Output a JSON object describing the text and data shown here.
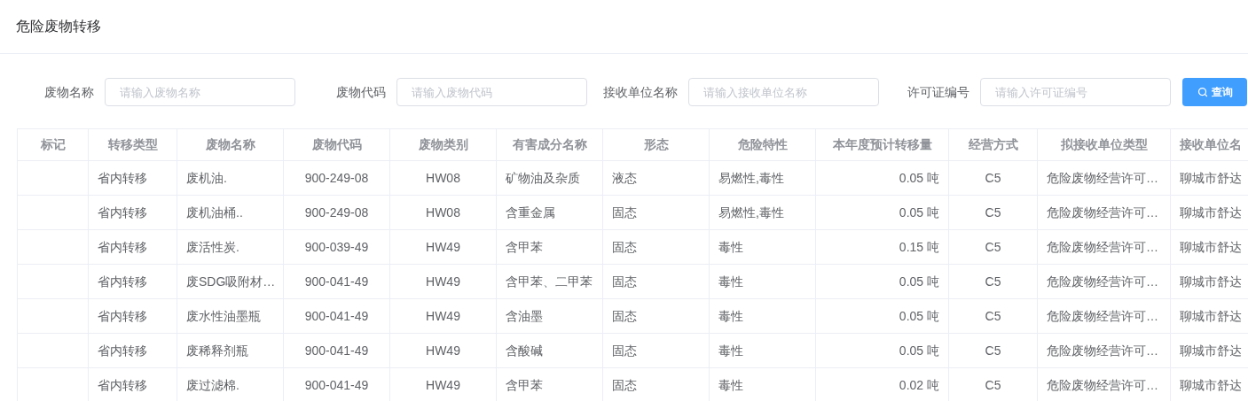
{
  "page": {
    "title": "危险废物转移"
  },
  "filters": [
    {
      "label": "废物名称",
      "placeholder": "请输入废物名称"
    },
    {
      "label": "废物代码",
      "placeholder": "请输入废物代码"
    },
    {
      "label": "接收单位名称",
      "placeholder": "请输入接收单位名称"
    },
    {
      "label": "许可证编号",
      "placeholder": "请输入许可证编号"
    }
  ],
  "search_button": {
    "label": "查询"
  },
  "table": {
    "columns": [
      "标记",
      "转移类型",
      "废物名称",
      "废物代码",
      "废物类别",
      "有害成分名称",
      "形态",
      "危险特性",
      "本年度预计转移量",
      "经营方式",
      "拟接收单位类型",
      "接收单位名"
    ],
    "rows": [
      {
        "transfer_type": "省内转移",
        "waste_name": "废机油.",
        "waste_code": "900-249-08",
        "waste_category": "HW08",
        "hazardous_component": "矿物油及杂质",
        "form": "液态",
        "hazard_property": "易燃性,毒性",
        "annual_amount": "0.05 吨",
        "operation_mode": "C5",
        "receiver_type": "危险废物经营许可…",
        "receiver_name": "聊城市舒达"
      },
      {
        "transfer_type": "省内转移",
        "waste_name": "废机油桶..",
        "waste_code": "900-249-08",
        "waste_category": "HW08",
        "hazardous_component": "含重金属",
        "form": "固态",
        "hazard_property": "易燃性,毒性",
        "annual_amount": "0.05 吨",
        "operation_mode": "C5",
        "receiver_type": "危险废物经营许可…",
        "receiver_name": "聊城市舒达"
      },
      {
        "transfer_type": "省内转移",
        "waste_name": "废活性炭.",
        "waste_code": "900-039-49",
        "waste_category": "HW49",
        "hazardous_component": "含甲苯",
        "form": "固态",
        "hazard_property": "毒性",
        "annual_amount": "0.15 吨",
        "operation_mode": "C5",
        "receiver_type": "危险废物经营许可…",
        "receiver_name": "聊城市舒达"
      },
      {
        "transfer_type": "省内转移",
        "waste_name": "废SDG吸附材…",
        "waste_code": "900-041-49",
        "waste_category": "HW49",
        "hazardous_component": "含甲苯、二甲苯",
        "form": "固态",
        "hazard_property": "毒性",
        "annual_amount": "0.05 吨",
        "operation_mode": "C5",
        "receiver_type": "危险废物经营许可…",
        "receiver_name": "聊城市舒达"
      },
      {
        "transfer_type": "省内转移",
        "waste_name": "废水性油墨瓶",
        "waste_code": "900-041-49",
        "waste_category": "HW49",
        "hazardous_component": "含油墨",
        "form": "固态",
        "hazard_property": "毒性",
        "annual_amount": "0.05 吨",
        "operation_mode": "C5",
        "receiver_type": "危险废物经营许可…",
        "receiver_name": "聊城市舒达"
      },
      {
        "transfer_type": "省内转移",
        "waste_name": "废稀释剂瓶",
        "waste_code": "900-041-49",
        "waste_category": "HW49",
        "hazardous_component": "含酸碱",
        "form": "固态",
        "hazard_property": "毒性",
        "annual_amount": "0.05 吨",
        "operation_mode": "C5",
        "receiver_type": "危险废物经营许可…",
        "receiver_name": "聊城市舒达"
      },
      {
        "transfer_type": "省内转移",
        "waste_name": "废过滤棉.",
        "waste_code": "900-041-49",
        "waste_category": "HW49",
        "hazardous_component": "含甲苯",
        "form": "固态",
        "hazard_property": "毒性",
        "annual_amount": "0.02 吨",
        "operation_mode": "C5",
        "receiver_type": "危险废物经营许可…",
        "receiver_name": "聊城市舒达"
      }
    ]
  }
}
